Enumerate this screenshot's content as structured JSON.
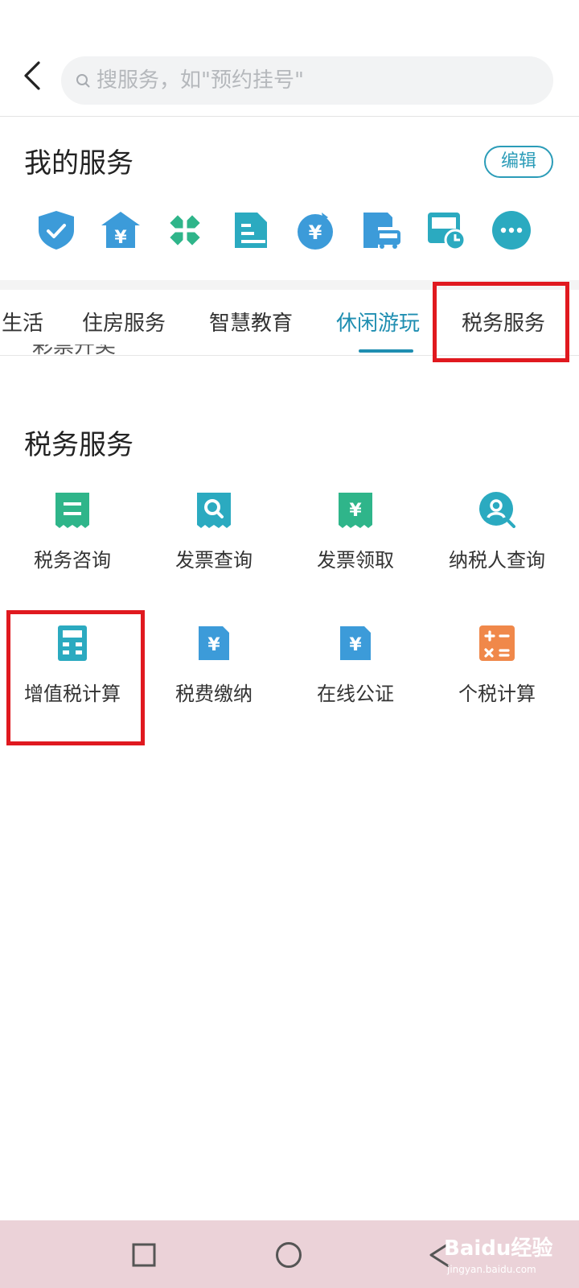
{
  "header": {
    "search_placeholder": "搜服务，如\"预约挂号\""
  },
  "my_services": {
    "title": "我的服务",
    "edit_label": "编辑",
    "icons": [
      "shield-check-icon",
      "bank-yuan-icon",
      "medical-cross-icon",
      "document-icon",
      "yuan-coin-icon",
      "car-parking-icon",
      "bus-clock-icon",
      "more-dots-icon"
    ]
  },
  "tabs": [
    {
      "label": "生活"
    },
    {
      "label": "住房服务"
    },
    {
      "label": "智慧教育"
    },
    {
      "label": "休闲游玩",
      "active": true
    },
    {
      "label": "税务服务"
    }
  ],
  "clipped_text": "彩票开奖",
  "tax_section": {
    "title": "税务服务",
    "items": [
      {
        "label": "税务咨询",
        "icon": "receipt-list-icon"
      },
      {
        "label": "发票查询",
        "icon": "receipt-search-icon"
      },
      {
        "label": "发票领取",
        "icon": "receipt-yuan-icon"
      },
      {
        "label": "纳税人查询",
        "icon": "person-search-icon"
      },
      {
        "label": "增值税计算",
        "icon": "calculator-icon"
      },
      {
        "label": "税费缴纳",
        "icon": "yuan-document-icon"
      },
      {
        "label": "在线公证",
        "icon": "yuan-document-icon"
      },
      {
        "label": "个税计算",
        "icon": "math-operators-icon"
      }
    ]
  },
  "watermark": {
    "text": "Baidu经验",
    "sub": "jingyan.baidu.com"
  },
  "colors": {
    "accent": "#1f8eb1",
    "highlight_box": "#e0191f",
    "nav_bar": "#ebd2d8"
  }
}
